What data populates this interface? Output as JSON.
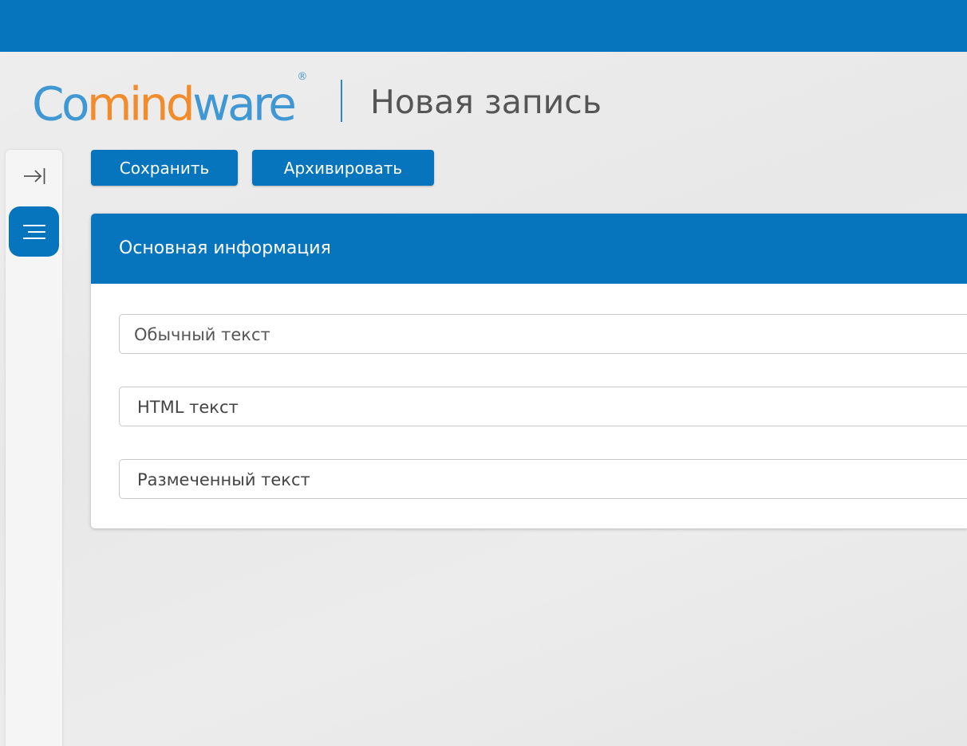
{
  "header": {
    "logo": {
      "part1": "Co",
      "part2": "mind",
      "part3": "ware",
      "registered": "®"
    },
    "page_title": "Новая запись"
  },
  "sidebar": {
    "collapse_icon": "arrow-right-to-bar-icon",
    "menu_icon": "hamburger-menu-icon"
  },
  "toolbar": {
    "save_label": "Сохранить",
    "archive_label": "Архивировать"
  },
  "form": {
    "section_title": "Основная информация",
    "fields": [
      {
        "label": "Обычный текст"
      },
      {
        "label": "HTML текст"
      },
      {
        "label": "Размеченный текст"
      }
    ]
  },
  "colors": {
    "brand_blue": "#0775bd",
    "logo_blue": "#3f97d4",
    "logo_orange": "#f08c2b",
    "background": "#ececec"
  }
}
